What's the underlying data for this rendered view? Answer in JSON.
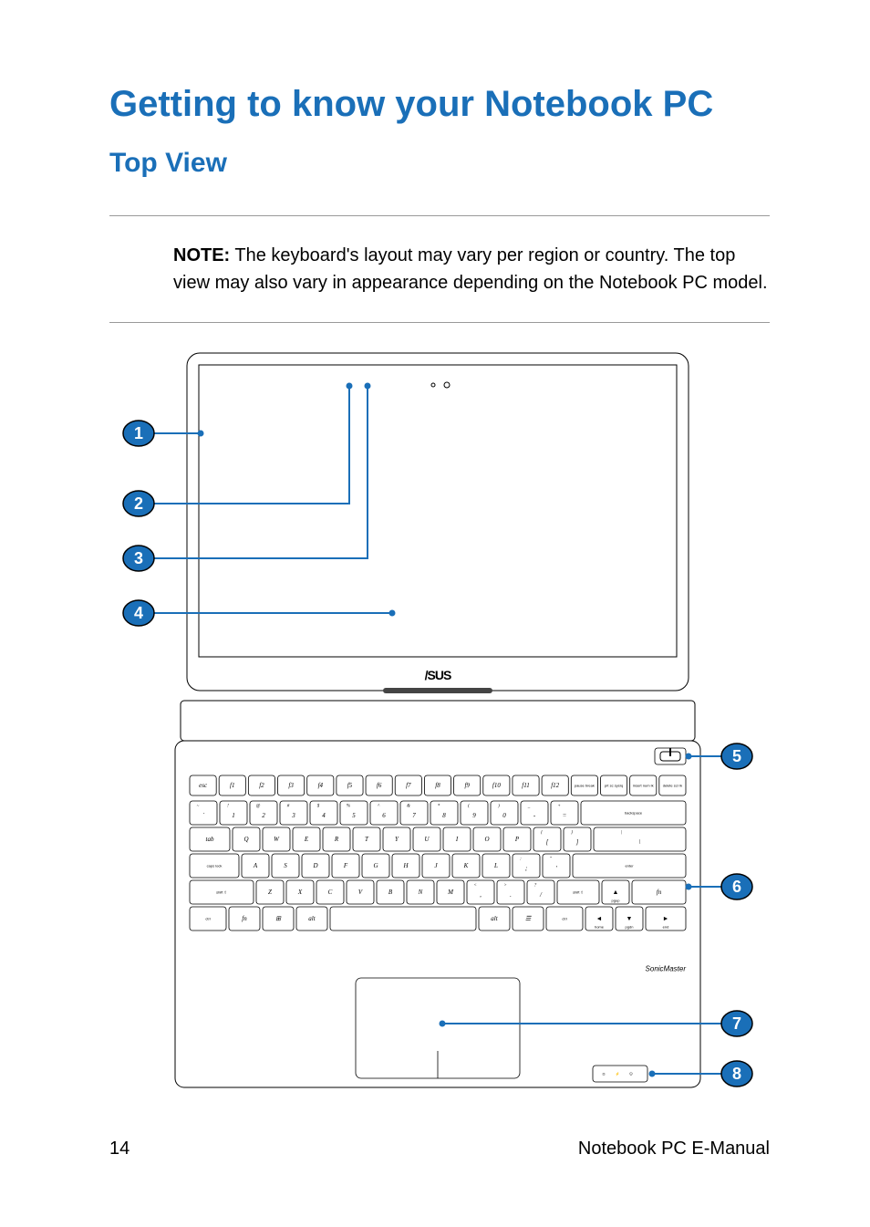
{
  "heading1": "Getting to know your Notebook PC",
  "heading2": "Top View",
  "note_label": "NOTE:",
  "note_body": " The keyboard's layout may vary per region or country. The top view may also vary in appearance depending on the Notebook PC model.",
  "callouts": {
    "1": "1",
    "2": "2",
    "3": "3",
    "4": "4",
    "5": "5",
    "6": "6",
    "7": "7",
    "8": "8"
  },
  "brand_logo": "/SUS",
  "sonic_label": "SonicMaster",
  "footer_page": "14",
  "footer_title": "Notebook PC E-Manual",
  "keyboard": {
    "row0": [
      "esc",
      "f1",
      "f2",
      "f3",
      "f4",
      "f5",
      "f6",
      "f7",
      "f8",
      "f9",
      "f10",
      "f11",
      "f12",
      "pause break",
      "prt sc sysrq",
      "insert num lk",
      "delete scr lk"
    ],
    "row1_upper": [
      "~",
      "!",
      "@",
      "#",
      "$",
      "%",
      "^",
      "&",
      "*",
      "(",
      ")",
      "_",
      "+"
    ],
    "row1_lower": [
      "`",
      "1",
      "2",
      "3",
      "4",
      "5",
      "6",
      "7",
      "8",
      "9",
      "0",
      "-",
      "="
    ],
    "row1_end": "backspace",
    "row2": [
      "tab",
      "Q",
      "W",
      "E",
      "R",
      "T",
      "Y",
      "U",
      "I",
      "O",
      "P",
      "[",
      "]",
      "\\"
    ],
    "row2_upper": [
      "",
      "",
      "",
      "",
      "",
      "",
      "",
      "",
      "",
      "",
      "",
      "{",
      "}",
      "|"
    ],
    "row3": [
      "caps lock",
      "A",
      "S",
      "D",
      "F",
      "G",
      "H",
      "J",
      "K",
      "L",
      ";",
      "'",
      "enter"
    ],
    "row3_upper": [
      "",
      "",
      "",
      "",
      "",
      "",
      "",
      "",
      "",
      "",
      ":",
      "\"",
      ""
    ],
    "row4": [
      "shift ⇧",
      "Z",
      "X",
      "C",
      "V",
      "B",
      "N",
      "M",
      ",",
      ".",
      "/",
      "shift ⇧",
      "▲",
      "fn"
    ],
    "row4_upper": [
      "",
      "",
      "",
      "",
      "",
      "",
      "",
      "",
      "<",
      ">",
      "?",
      "",
      "pgup",
      ""
    ],
    "row5": [
      "ctrl",
      "fn",
      "⊞",
      "alt",
      "",
      "alt",
      "☰",
      "ctrl",
      "◄",
      "▼",
      "►"
    ],
    "row5_sub": [
      "",
      "",
      "",
      "",
      "",
      "",
      "",
      "",
      "home",
      "pgdn",
      "end"
    ]
  }
}
